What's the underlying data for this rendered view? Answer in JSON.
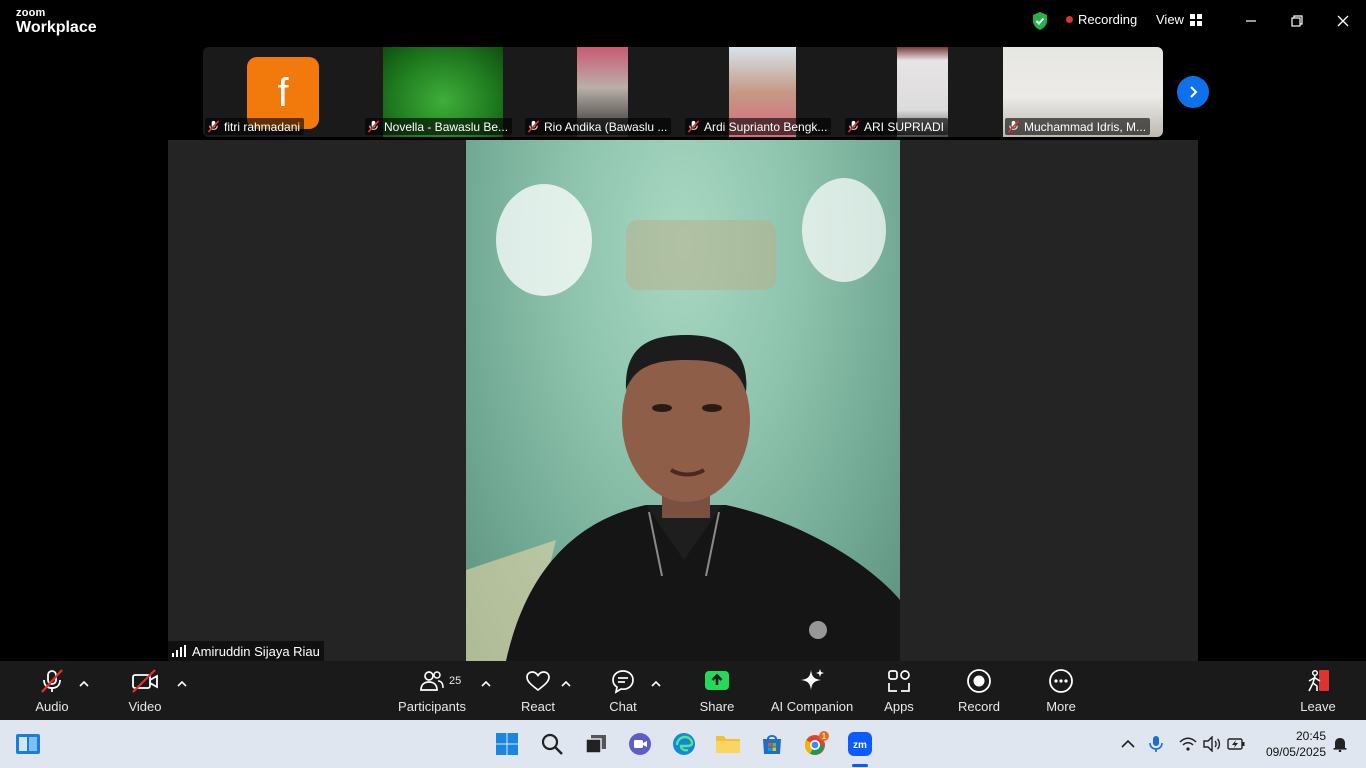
{
  "app": {
    "brand_small": "zoom",
    "brand_big": "Workplace",
    "recording_label": "Recording",
    "view_label": "View"
  },
  "thumbnails": [
    {
      "name": "fitri rahmadani",
      "avatar_letter": "f",
      "avatar_color": "#f27a0d",
      "muted": true
    },
    {
      "name": "Novella - Bawaslu Be...",
      "muted": true
    },
    {
      "name": "Rio Andika (Bawaslu ...",
      "muted": true
    },
    {
      "name": "Ardi Suprianto Bengk...",
      "muted": true
    },
    {
      "name": "ARI SUPRIADI",
      "muted": true
    },
    {
      "name": "Muchammad Idris, M...",
      "muted": true
    }
  ],
  "speaker": {
    "name": "Amiruddin Sijaya Riau"
  },
  "toolbar": {
    "audio": "Audio",
    "video": "Video",
    "participants": "Participants",
    "participant_count": "25",
    "react": "React",
    "chat": "Chat",
    "share": "Share",
    "ai_companion": "AI Companion",
    "apps": "Apps",
    "record": "Record",
    "more": "More",
    "leave": "Leave"
  },
  "taskbar": {
    "time": "20:45",
    "date": "09/05/2025",
    "chrome_badge": "1"
  },
  "colors": {
    "accent_blue": "#0e71eb",
    "share_green": "#23d959",
    "muted_red": "#e0332f",
    "leave_red": "#e0332f"
  }
}
